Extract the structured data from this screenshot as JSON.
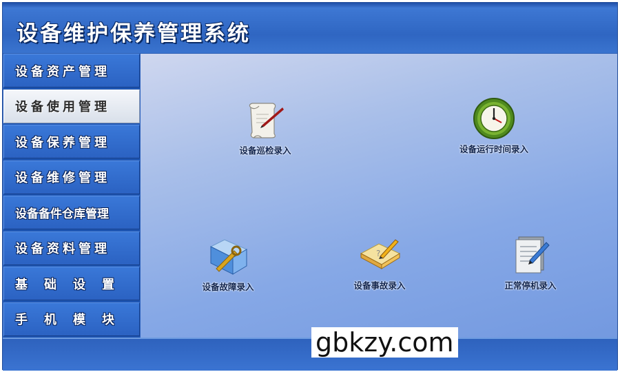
{
  "app": {
    "title": "设备维护保养管理系统"
  },
  "sidebar": {
    "items": [
      {
        "label": "设备资产管理",
        "active": false
      },
      {
        "label": "设备使用管理",
        "active": true
      },
      {
        "label": "设备保养管理",
        "active": false
      },
      {
        "label": "设备维修管理",
        "active": false
      },
      {
        "label": "设备备件仓库管理",
        "active": false
      },
      {
        "label": "设备资料管理",
        "active": false
      },
      {
        "label": "基础设置",
        "active": false
      },
      {
        "label": "手机模块",
        "active": false
      }
    ]
  },
  "main": {
    "tiles": [
      {
        "label": "设备巡检录入",
        "icon": "scroll-quill-icon"
      },
      {
        "label": "设备运行时间录入",
        "icon": "clock-icon"
      },
      {
        "label": "设备故障录入",
        "icon": "folder-wrench-icon"
      },
      {
        "label": "设备事故录入",
        "icon": "notebook-pencil-icon"
      },
      {
        "label": "正常停机录入",
        "icon": "document-pen-icon"
      }
    ]
  },
  "watermark": "gbkzy.com",
  "colors": {
    "frame": "#2f64bf",
    "sidebar": "#2b62c2",
    "active_item": "#e8ecf2",
    "content_light": "#cfd7ef",
    "content_dark": "#7399e0"
  }
}
